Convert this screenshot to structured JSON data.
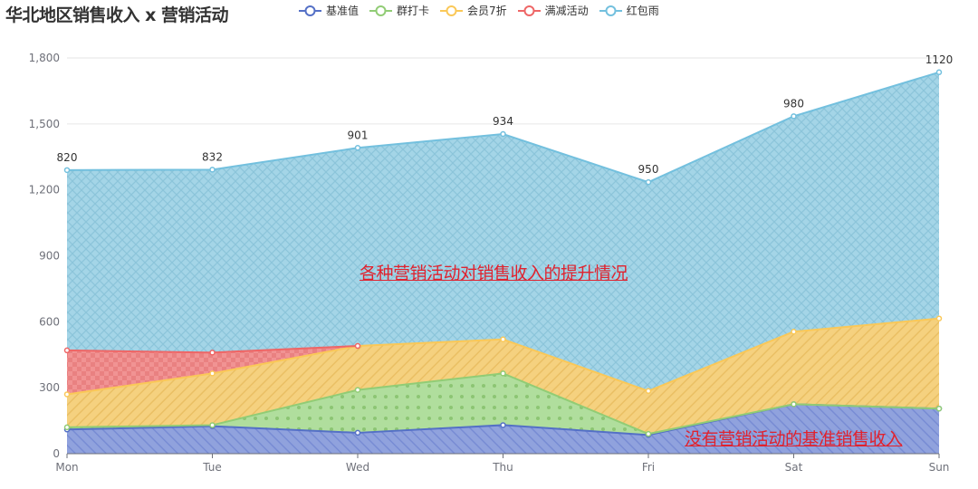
{
  "chart_data": {
    "type": "area",
    "stacked": true,
    "title": "华北地区销售收入 x 营销活动",
    "xlabel": "",
    "ylabel": "",
    "categories": [
      "Mon",
      "Tue",
      "Wed",
      "Thu",
      "Fri",
      "Sat",
      "Sun"
    ],
    "ylim": [
      0,
      1800
    ],
    "yticks": [
      0,
      300,
      600,
      900,
      1200,
      1500,
      1800
    ],
    "ytick_labels": [
      "0",
      "300",
      "600",
      "900",
      "1,200",
      "1,500",
      "1,800"
    ],
    "grid": true,
    "legend_position": "top",
    "series": [
      {
        "name": "基准值",
        "color": "#5470c6",
        "pattern": "diagonal-lines",
        "values": [
          110,
          125,
          95,
          130,
          85,
          225,
          205
        ]
      },
      {
        "name": "群打卡",
        "color": "#91cc75",
        "pattern": "dots",
        "values": [
          10,
          5,
          195,
          235,
          5,
          0,
          0
        ]
      },
      {
        "name": "会员7折",
        "color": "#fac858",
        "pattern": "diagonal-lines",
        "values": [
          150,
          235,
          200,
          155,
          195,
          330,
          410
        ]
      },
      {
        "name": "满减活动",
        "color": "#ee6666",
        "pattern": "checker",
        "values": [
          200,
          95,
          0,
          null,
          null,
          null,
          null
        ]
      },
      {
        "name": "红包雨",
        "color": "#73c0de",
        "pattern": "crosshatch",
        "values": [
          820,
          832,
          901,
          934,
          950,
          980,
          1120
        ],
        "show_labels": true
      }
    ],
    "annotations": [
      {
        "text": "各种营销活动对销售收入的提升情况",
        "color": "#e0222e"
      },
      {
        "text": "没有营销活动的基准销售收入",
        "color": "#e0222e"
      }
    ]
  }
}
